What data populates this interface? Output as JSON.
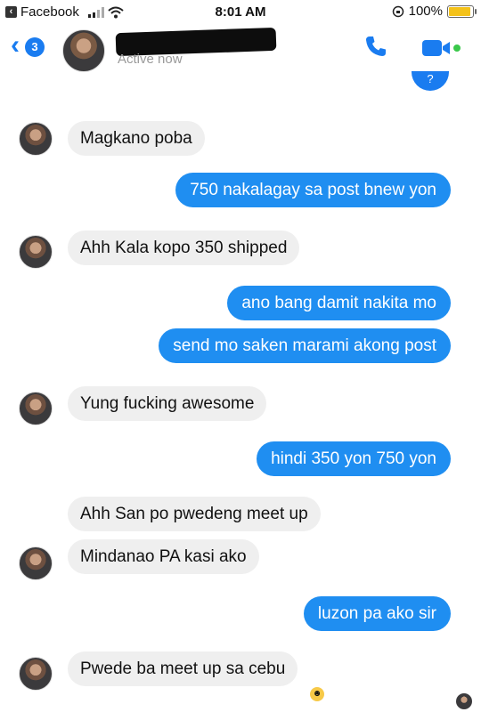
{
  "status_bar": {
    "back_app": "Facebook",
    "time": "8:01 AM",
    "battery_text": "100%",
    "battery_level": 1.0,
    "icons": [
      "back-icon",
      "signal-icon",
      "wifi-icon",
      "orientation-lock-icon",
      "battery-icon"
    ]
  },
  "header": {
    "unread_count": "3",
    "status": "Active now",
    "icons": [
      "chevron-left-icon",
      "phone-icon",
      "video-camera-icon"
    ],
    "accent": "#1a7cf0"
  },
  "messages": [
    {
      "side": "in",
      "text": "Magkano poba"
    },
    {
      "side": "out",
      "text": "750 nakalagay sa post bnew yon"
    },
    {
      "side": "in",
      "text": "Ahh Kala kopo 350 shipped"
    },
    {
      "side": "out",
      "text": "ano bang damit nakita mo"
    },
    {
      "side": "out",
      "text": "send mo saken marami akong post"
    },
    {
      "side": "in",
      "text": "Yung fucking awesome"
    },
    {
      "side": "out",
      "text": "hindi 350 yon 750 yon"
    },
    {
      "side": "in",
      "text": "Ahh San po pwedeng meet up"
    },
    {
      "side": "in",
      "text": "Mindanao PA kasi ako"
    },
    {
      "side": "out",
      "text": "luzon pa ako sir"
    },
    {
      "side": "in",
      "text": "Pwede ba meet up sa cebu"
    }
  ],
  "colors": {
    "outgoing_bubble": "#1f8ef1",
    "incoming_bubble": "#efefef"
  }
}
